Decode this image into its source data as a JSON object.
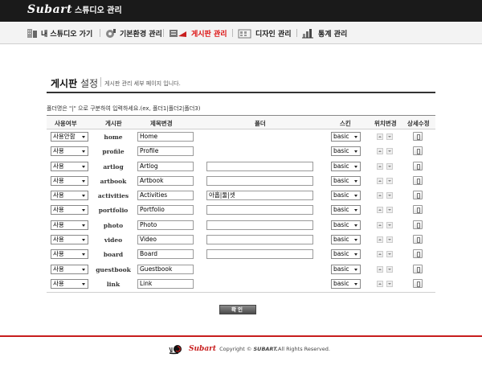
{
  "header": {
    "brand": "Subart",
    "title": "스튜디오 관리"
  },
  "nav": [
    {
      "label": "내 스튜디오 가기",
      "icon": "studio-icon"
    },
    {
      "label": "기본환경 관리",
      "icon": "settings-icon"
    },
    {
      "label": "게시판 관리",
      "icon": "board-icon",
      "active": true
    },
    {
      "label": "디자인 관리",
      "icon": "design-icon"
    },
    {
      "label": "통계 관리",
      "icon": "stats-icon"
    }
  ],
  "page": {
    "title_bold": "게시판",
    "title_thin": " 설정",
    "description": "게시판 관리 세부 페이지 입니다.",
    "help": "폴더명은 \"|\" 으로 구분하여 입력하세요.(ex, 폴더1|폴더2|폴더3)"
  },
  "table": {
    "headers": [
      "사용여부",
      "게시판",
      "제목변경",
      "폴더",
      "스킨",
      "위치변경",
      "상세수정"
    ],
    "rows": [
      {
        "use": "사용안함",
        "board": "home",
        "name": "Home",
        "folder": null,
        "skin": "basic"
      },
      {
        "use": "사용",
        "board": "profile",
        "name": "Profile",
        "folder": null,
        "skin": "basic"
      },
      {
        "use": "사용",
        "board": "artlog",
        "name": "Artlog",
        "folder": "",
        "skin": "basic"
      },
      {
        "use": "사용",
        "board": "artbook",
        "name": "Artbook",
        "folder": "",
        "skin": "basic"
      },
      {
        "use": "사용",
        "board": "activities",
        "name": "Activities",
        "folder": "아홉|둘|셋",
        "skin": "basic"
      },
      {
        "use": "사용",
        "board": "portfolio",
        "name": "Portfolio",
        "folder": "",
        "skin": "basic"
      },
      {
        "use": "사용",
        "board": "photo",
        "name": "Photo",
        "folder": "",
        "skin": "basic"
      },
      {
        "use": "사용",
        "board": "video",
        "name": "Video",
        "folder": "",
        "skin": "basic"
      },
      {
        "use": "사용",
        "board": "board",
        "name": "Board",
        "folder": "",
        "skin": "basic"
      },
      {
        "use": "사용",
        "board": "guestbook",
        "name": "Guestbook",
        "folder": null,
        "skin": "basic"
      },
      {
        "use": "사용",
        "board": "link",
        "name": "Link",
        "folder": null,
        "skin": "basic"
      }
    ]
  },
  "confirm_label": "확인",
  "footer": {
    "brand": "Subart",
    "copy_prefix": "Copyright ©",
    "copy_brand": "SUBART.",
    "copy_suffix": "All Rights Reserved."
  },
  "colors": {
    "accent": "#c81e1e",
    "topbar": "#1a1a1a",
    "active_nav": "#dd1111"
  }
}
